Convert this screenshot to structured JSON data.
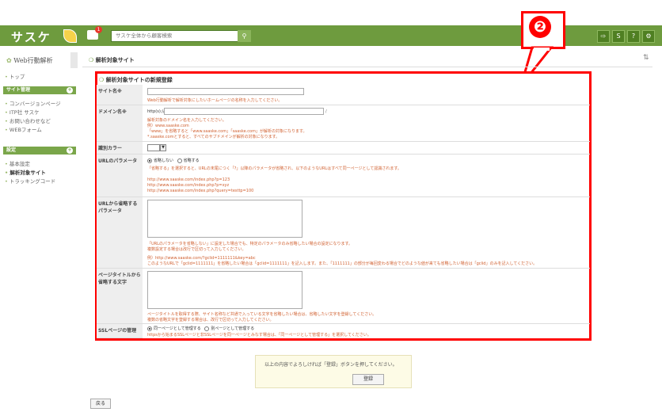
{
  "header": {
    "logo": "サスケ",
    "notification_count": "1",
    "search_placeholder": "サスケ全体から顧客検索",
    "callout_number": "❷"
  },
  "sidebar": {
    "title": "Web行動解析",
    "top_link": "トップ",
    "sections": [
      {
        "label": "サイト管理",
        "items": [
          "コンバージョンページ",
          "ITP社 サスケ",
          "お問い合わせなど",
          "WEBフォーム"
        ]
      },
      {
        "label": "設定",
        "items": [
          "基本設定",
          "解析対象サイト",
          "トラッキングコード"
        ]
      }
    ]
  },
  "main": {
    "page_title": "解析対象サイト",
    "form_title": "解析対象サイトの新規登録",
    "rows": {
      "site_name": {
        "label": "サイト名※",
        "note": "Web行動解析で解析対象にしたいホームページの名称を入力してください。"
      },
      "domain": {
        "label": "ドメイン名※",
        "prefix": "http(s)://",
        "suffix": "/",
        "note1": "解析対象のドメイン名を入力してください。",
        "note2": "例）www.saaske.com",
        "note3": "「www」を省略すると「www.saaske.com」「saaske.com」が解析の対象になります。",
        "note4": "*.saaske.comとすると、すべてのサブドメインが解析の対象になります。"
      },
      "color": {
        "label": "識別カラー"
      },
      "url_param": {
        "label": "URLのパラメータ",
        "option1": "省略しない",
        "option2": "省略する",
        "note": "「省略する」を選択すると、URLの末尾につく「?」以降のパラメータが省略され、以下のようなURLはすべて同一ページとして認識されます。",
        "examples": [
          "http://www.saaske.com/index.php?p=123",
          "http://www.saaske.com/index.php?p=xyz",
          "http://www.saaske.com/index.php?query=testtp=100"
        ]
      },
      "omit_param": {
        "label": "URLから省略するパラメータ",
        "note1": "「URLのパラメータを省略しない」に設定した場合でも、特定のパラメータのみ省略したい場合の設定になります。",
        "note2": "複数設定する場合は改行で区切って入力してください。",
        "example1": "例）http://www.saaske.com/?gclid=1111111&key=abc",
        "example2": "このようなURLで「gclid=1111111」を省略したい場合は「gclid=1111111」を記入します。また、「1111111」の部分が毎回変わる場合でどのような値が来ても省略したい場合は「gclid」のみを記入してください。"
      },
      "title_omit": {
        "label": "ページタイトルから省略する文字",
        "note1": "ページタイトルを取得する際、サイト名称など共通で入っている文字を省略したい場合は、省略したい文字を登録してください。",
        "note2": "複数の省略文字を登録する場合は、改行で区切って入力してください。"
      },
      "ssl": {
        "label": "SSLページの管理",
        "option1": "同一ページとして管理する",
        "option2": "別ページとして管理する",
        "note": "httpsから始まるSSLページと非SSLページを同一ページとみなす場合は、「同一ページとして管理する」を選択してください。"
      }
    },
    "confirm_text": "以上の内容でよろしければ「登録」ボタンを押してください。",
    "register_label": "登録",
    "back_label": "戻る"
  },
  "colors": {
    "nav": "#6e9b3e",
    "highlight": "#ff0000",
    "note": "#d06030"
  }
}
